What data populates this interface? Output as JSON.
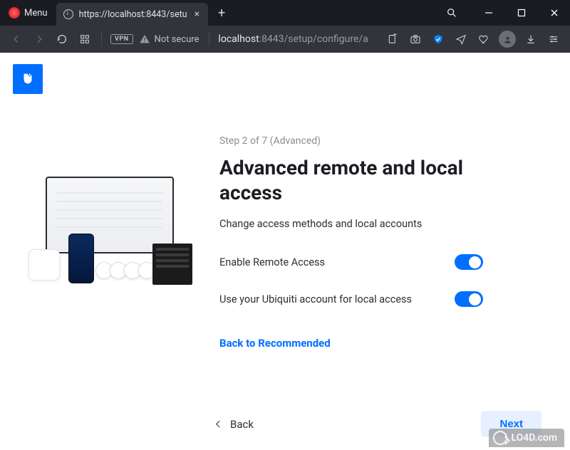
{
  "browser": {
    "menu_label": "Menu",
    "tab_title": "https://localhost:8443/setu",
    "address_host": "localhost",
    "address_path": ":8443/setup/configure/a",
    "not_secure_label": "Not secure",
    "vpn_label": "VPN"
  },
  "setup": {
    "step_label": "Step 2 of 7 (Advanced)",
    "title": "Advanced remote and local access",
    "subtitle": "Change access methods and local accounts",
    "toggles": [
      {
        "label": "Enable Remote Access",
        "value": true
      },
      {
        "label": "Use your Ubiquiti account for local access",
        "value": true
      }
    ],
    "back_to_recommended": "Back to Recommended",
    "back_label": "Back",
    "next_label": "Next"
  },
  "watermark": "LO4D.com"
}
